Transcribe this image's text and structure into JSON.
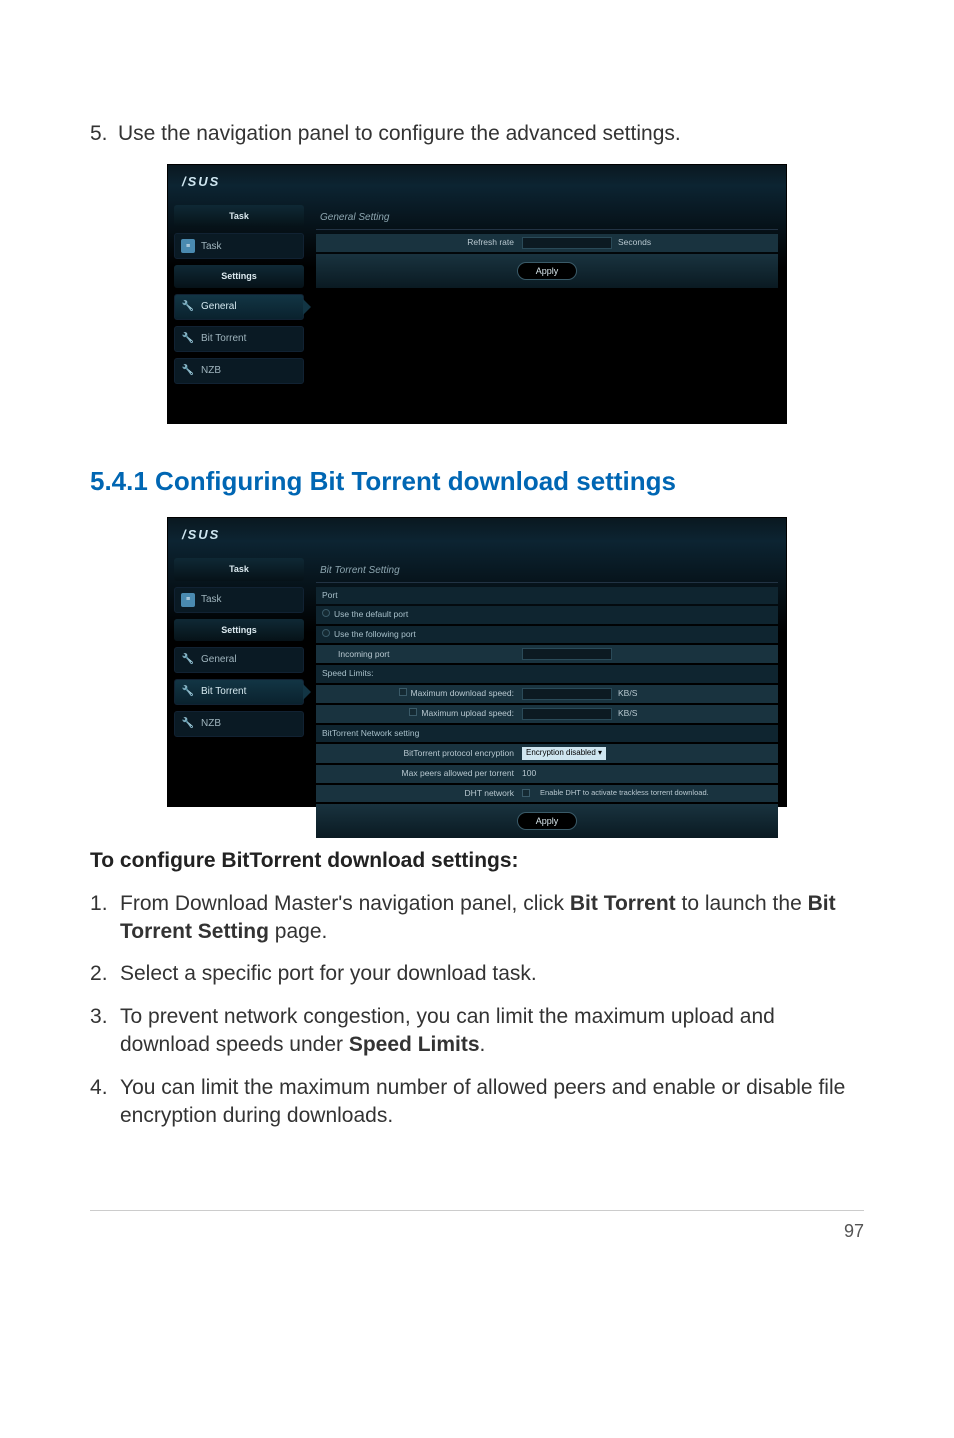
{
  "step5": {
    "num": "5.",
    "text": "Use the navigation panel to configure the advanced settings."
  },
  "section_heading": "5.4.1  Configuring Bit Torrent download settings",
  "sub_heading": "To configure BitTorrent download settings:",
  "steps": [
    {
      "pre": "From Download Master's navigation panel, click ",
      "bold1": "Bit Torrent",
      "mid": " to launch the ",
      "bold2": "Bit Torrent Setting",
      "post": " page."
    },
    {
      "pre": "Select a specific port for your download task.",
      "bold1": "",
      "mid": "",
      "bold2": "",
      "post": ""
    },
    {
      "pre": "To prevent network congestion, you can limit the maximum upload and download speeds under ",
      "bold1": "Speed Limits",
      "mid": ".",
      "bold2": "",
      "post": ""
    },
    {
      "pre": "You can limit the maximum number of allowed peers and enable or disable file encryption during downloads.",
      "bold1": "",
      "mid": "",
      "bold2": "",
      "post": ""
    }
  ],
  "page_number": "97",
  "ss1": {
    "logo": "/SUS",
    "task_header": "Task",
    "task_item": "Task",
    "settings_header": "Settings",
    "general": "General",
    "bittorrent": "Bit Torrent",
    "nzb": "NZB",
    "panel_title": "General Setting",
    "refresh_label": "Refresh rate",
    "seconds": "Seconds",
    "apply": "Apply"
  },
  "ss2": {
    "logo": "/SUS",
    "task_header": "Task",
    "task_item": "Task",
    "settings_header": "Settings",
    "general": "General",
    "bittorrent": "Bit Torrent",
    "nzb": "NZB",
    "panel_title": "Bit Torrent Setting",
    "port_header": "Port",
    "use_default": "Use the default port",
    "use_following": "Use the following port",
    "incoming_port": "Incoming port",
    "speed_header": "Speed Limits:",
    "max_dl": "Maximum download speed:",
    "max_ul": "Maximum upload speed:",
    "kbs": "KB/S",
    "net_header": "BitTorrent Network setting",
    "enc_label": "BitTorrent protocol encryption",
    "enc_value": "Encryption disabled ▾",
    "max_peers": "Max peers allowed per torrent",
    "max_peers_val": "100",
    "dht": "DHT network",
    "dht_note": "Enable DHT to activate trackless torrent download.",
    "apply": "Apply"
  }
}
